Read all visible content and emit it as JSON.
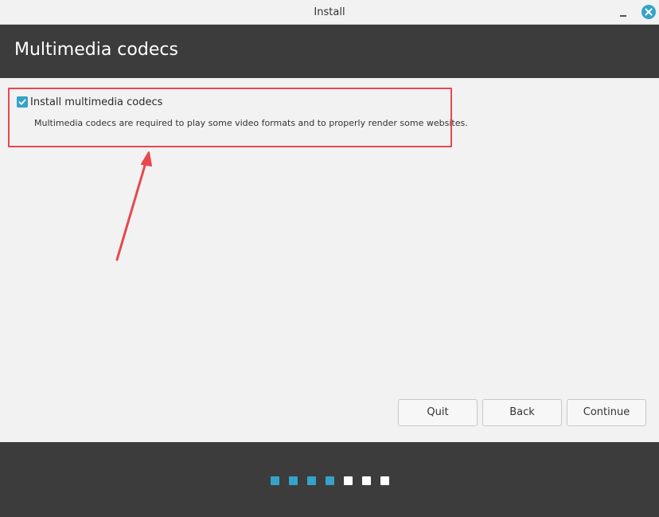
{
  "window": {
    "title": "Install"
  },
  "header": {
    "title": "Multimedia codecs"
  },
  "option": {
    "label": "Install multimedia codecs",
    "checked": true,
    "description": "Multimedia codecs are required to play some video formats and to properly render some websites."
  },
  "buttons": {
    "quit": "Quit",
    "back": "Back",
    "continue": "Continue"
  },
  "progress": {
    "total_steps": 7,
    "completed_steps": 4
  },
  "colors": {
    "accent": "#35a2c9",
    "annotation": "#e8474f",
    "header_bg": "#3c3c3c",
    "content_bg": "#f2f2f2"
  },
  "icons": {
    "checkbox": "check-icon",
    "close": "close-icon",
    "minimize": "minimize-icon"
  }
}
